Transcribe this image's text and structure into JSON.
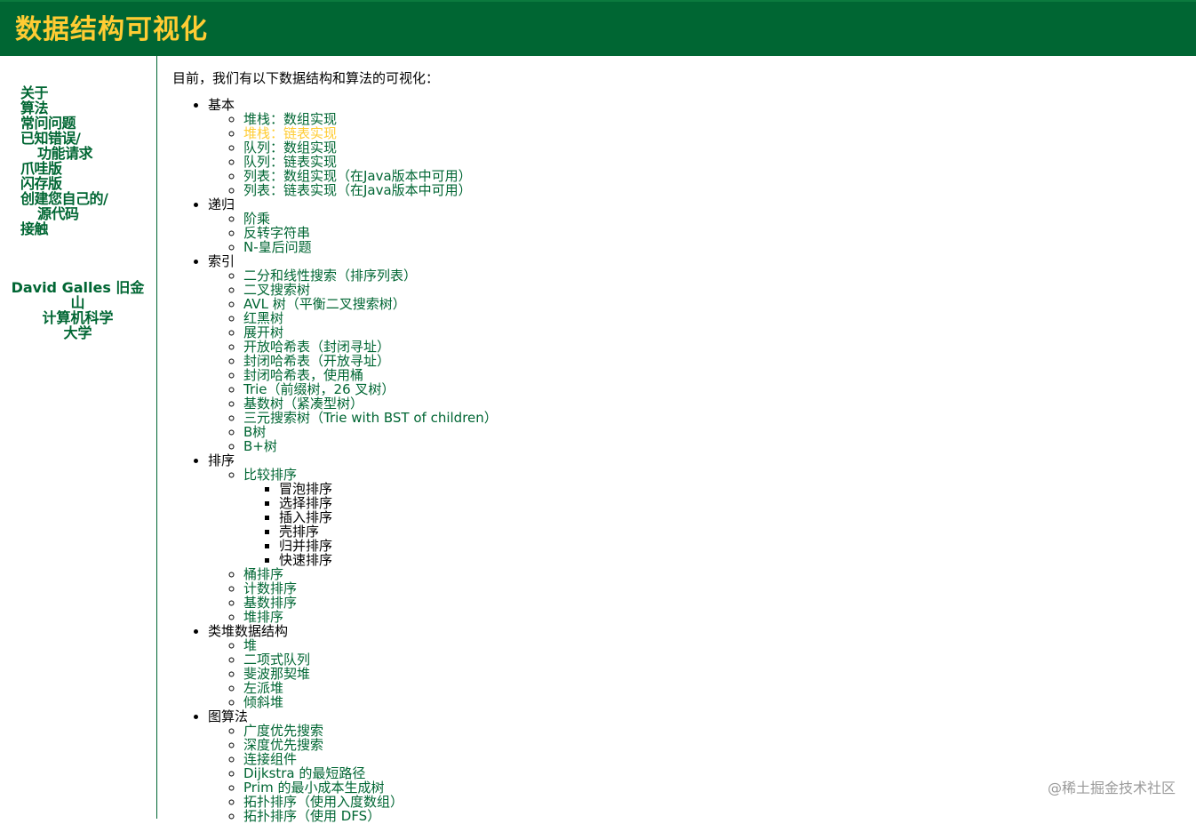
{
  "header": {
    "title": "数据结构可视化"
  },
  "sidebar": {
    "nav": [
      {
        "label": "关于"
      },
      {
        "label": "算法"
      },
      {
        "label": "常问问题"
      },
      {
        "label": "已知错误/",
        "label2": "功能请求"
      },
      {
        "label": "爪哇版"
      },
      {
        "label": "闪存版"
      },
      {
        "label": "创建您自己的/",
        "label2": "源代码"
      },
      {
        "label": "接触"
      }
    ],
    "author": {
      "line1": "David Galles 旧金",
      "line2": "山",
      "line3": "计算机科学",
      "line4": "大学"
    }
  },
  "main": {
    "intro": "目前，我们有以下数据结构和算法的可视化：",
    "categories": [
      {
        "label": "基本",
        "items": [
          {
            "label": "堆栈：数组实现"
          },
          {
            "label": "堆栈：链表实现"
          },
          {
            "label": "队列：数组实现"
          },
          {
            "label": "队列：链表实现"
          },
          {
            "label": "列表：数组实现（在Java版本中可用）"
          },
          {
            "label": "列表：链表实现（在Java版本中可用）"
          }
        ]
      },
      {
        "label": "递归",
        "items": [
          {
            "label": "阶乘"
          },
          {
            "label": "反转字符串"
          },
          {
            "label": "N-皇后问题"
          }
        ]
      },
      {
        "label": "索引",
        "items": [
          {
            "label": "二分和线性搜索（排序列表）"
          },
          {
            "label": "二叉搜索树"
          },
          {
            "label": "AVL 树（平衡二叉搜索树）"
          },
          {
            "label": "红黑树"
          },
          {
            "label": "展开树"
          },
          {
            "label": "开放哈希表（封闭寻址）"
          },
          {
            "label": "封闭哈希表（开放寻址）"
          },
          {
            "label": "封闭哈希表，使用桶"
          },
          {
            "label": "Trie（前缀树，26 叉树）"
          },
          {
            "label": "基数树（紧凑型树）"
          },
          {
            "label": "三元搜索树（Trie with BST of children）"
          },
          {
            "label": "B树"
          },
          {
            "label": "B+树"
          }
        ]
      },
      {
        "label": "排序",
        "items": [
          {
            "label": "比较排序",
            "sub": [
              "冒泡排序",
              "选择排序",
              "插入排序",
              "壳排序",
              "归并排序",
              "快速排序"
            ]
          },
          {
            "label": "桶排序"
          },
          {
            "label": "计数排序"
          },
          {
            "label": "基数排序"
          },
          {
            "label": "堆排序"
          }
        ]
      },
      {
        "label": "类堆数据结构",
        "items": [
          {
            "label": "堆"
          },
          {
            "label": "二项式队列"
          },
          {
            "label": "斐波那契堆"
          },
          {
            "label": "左派堆"
          },
          {
            "label": "倾斜堆"
          }
        ]
      },
      {
        "label": "图算法",
        "items": [
          {
            "label": "广度优先搜索"
          },
          {
            "label": "深度优先搜索"
          },
          {
            "label": "连接组件"
          },
          {
            "label": "Dijkstra 的最短路径"
          },
          {
            "label": "Prim 的最小成本生成树"
          },
          {
            "label": "拓扑排序（使用入度数组）"
          },
          {
            "label": "拓扑排序（使用 DFS）"
          }
        ]
      }
    ]
  },
  "watermark": "@稀土掘金技术社区",
  "colors": {
    "brand_green": "#006633",
    "title_gold": "#ffcc33"
  }
}
